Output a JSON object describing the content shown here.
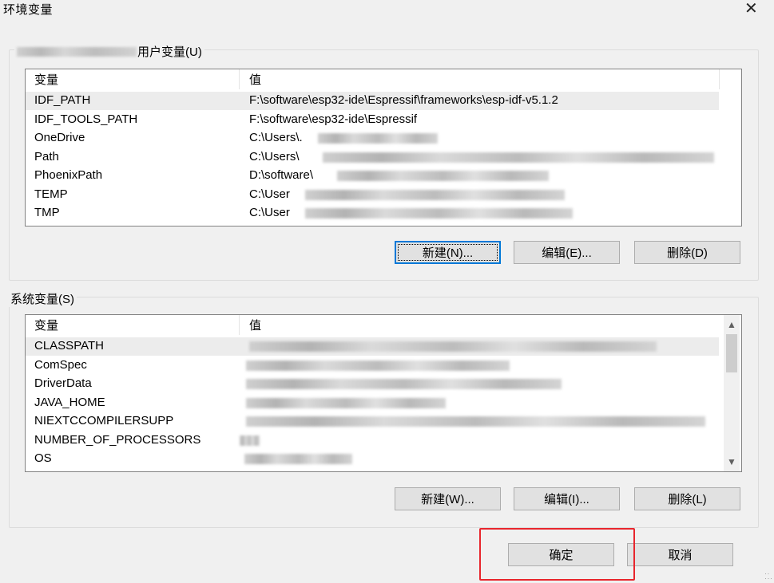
{
  "window": {
    "title": "环境变量",
    "close_glyph": "✕"
  },
  "user_vars": {
    "group_label": "用户变量(U)",
    "columns": [
      "变量",
      "值"
    ],
    "rows": [
      {
        "name": "IDF_PATH",
        "value": "F:\\software\\esp32-ide\\Espressif\\frameworks\\esp-idf-v5.1.2"
      },
      {
        "name": "IDF_TOOLS_PATH",
        "value": "F:\\software\\esp32-ide\\Espressif"
      },
      {
        "name": "OneDrive",
        "value": "C:\\Users\\."
      },
      {
        "name": "Path",
        "value": "C:\\Users\\"
      },
      {
        "name": "PhoenixPath",
        "value": "D:\\software\\"
      },
      {
        "name": "TEMP",
        "value": "C:\\User"
      },
      {
        "name": "TMP",
        "value": "C:\\User"
      }
    ],
    "buttons": {
      "new": "新建(N)...",
      "edit": "编辑(E)...",
      "delete": "删除(D)"
    }
  },
  "system_vars": {
    "group_label": "系统变量(S)",
    "columns": [
      "变量",
      "值"
    ],
    "rows": [
      {
        "name": "CLASSPATH",
        "value": ""
      },
      {
        "name": "ComSpec",
        "value": ""
      },
      {
        "name": "DriverData",
        "value": ""
      },
      {
        "name": "JAVA_HOME",
        "value": ""
      },
      {
        "name": "NIEXTCCOMPILERSUPP",
        "value": ""
      },
      {
        "name": "NUMBER_OF_PROCESSORS",
        "value": ""
      },
      {
        "name": "OS",
        "value": ""
      }
    ],
    "buttons": {
      "new": "新建(W)...",
      "edit": "编辑(I)...",
      "delete": "删除(L)"
    }
  },
  "footer": {
    "ok": "确定",
    "cancel": "取消"
  },
  "colors": {
    "accent": "#0078d7",
    "annotation": "#e8262d",
    "selection": "#ececec"
  },
  "icons": {
    "close": "close-icon",
    "scroll_up": "chevron-up-icon",
    "scroll_down": "chevron-down-icon",
    "resize": "resize-grip-icon"
  }
}
